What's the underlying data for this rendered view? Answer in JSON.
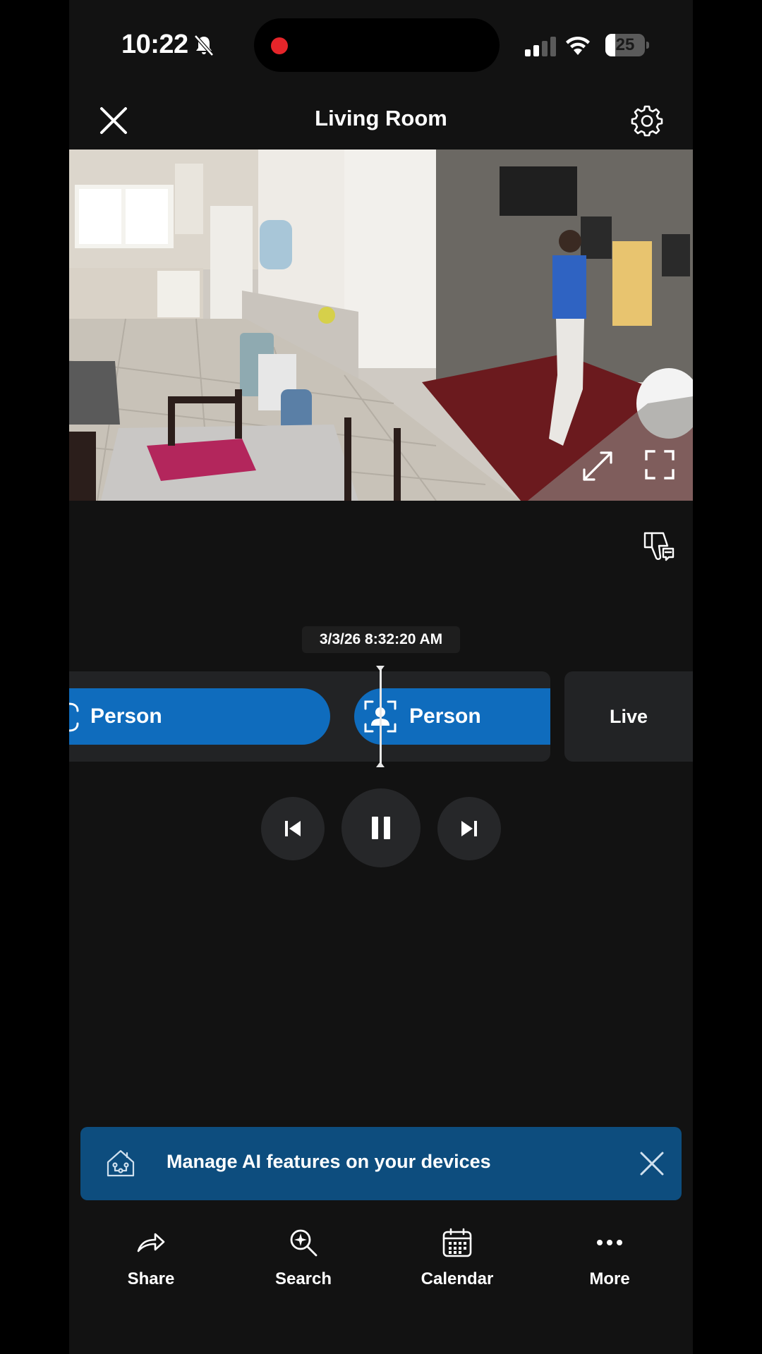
{
  "status_bar": {
    "time": "10:22",
    "battery_percent": 25,
    "battery_label": "25",
    "recording": true
  },
  "header": {
    "title": "Living Room"
  },
  "player": {
    "timestamp": "3/3/26 8:32:20 AM",
    "events": [
      {
        "label": "Person"
      },
      {
        "label": "Person"
      }
    ],
    "live_label": "Live"
  },
  "banner": {
    "text": "Manage AI features on your devices"
  },
  "nav": {
    "share": "Share",
    "search": "Search",
    "calendar": "Calendar",
    "more": "More"
  },
  "colors": {
    "background": "#121212",
    "accent_blue": "#0f6cbd",
    "banner_blue": "#0d4d7e",
    "recording_red": "#e5252a"
  },
  "icons": {
    "close": "close-icon",
    "settings": "gear-icon",
    "expand": "expand-icon",
    "fullscreen": "fullscreen-icon",
    "feedback": "thumbs-down-feedback-icon",
    "person": "person-detect-icon",
    "ai": "smart-home-icon",
    "share": "share-arrow-icon",
    "search": "ai-search-icon",
    "calendar": "calendar-icon",
    "more": "more-dots-icon"
  }
}
